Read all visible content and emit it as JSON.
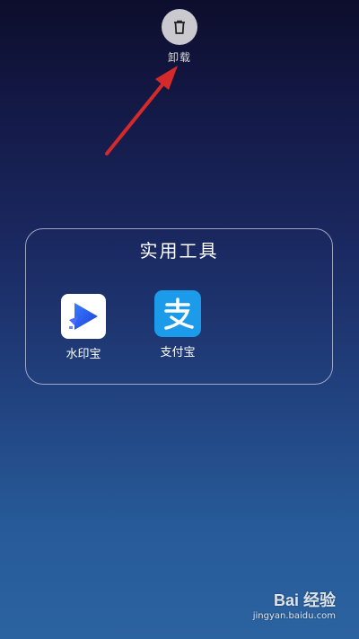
{
  "uninstall": {
    "label": "卸载",
    "icon": "trash-icon"
  },
  "folder": {
    "title": "实用工具",
    "apps": [
      {
        "label": "水印宝",
        "icon": "watermark-app-icon",
        "color": "#ffffff"
      },
      {
        "label": "支付宝",
        "icon": "alipay-icon",
        "color": "#1c9bea"
      }
    ]
  },
  "annotation": {
    "arrow_color": "#d42a2a"
  },
  "watermark": {
    "logo": "Bai 经验",
    "url": "jingyan.baidu.com"
  }
}
